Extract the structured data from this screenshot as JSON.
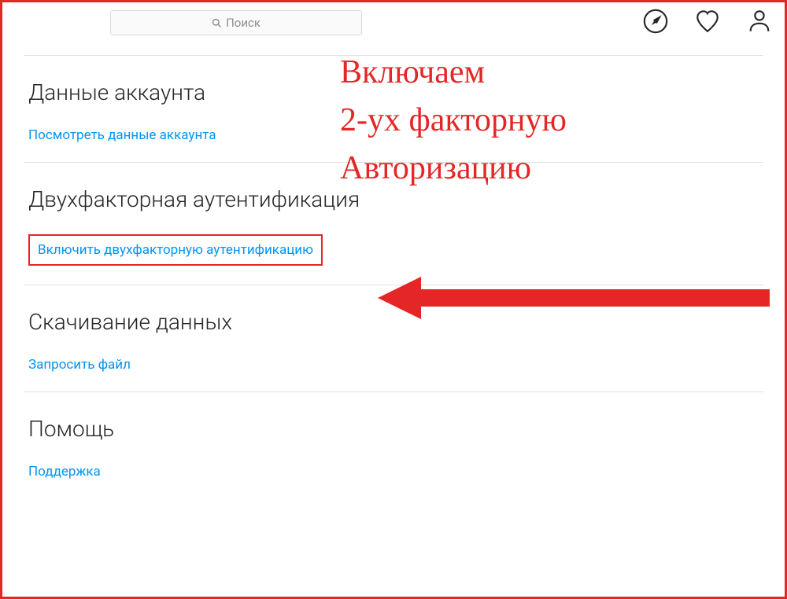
{
  "search": {
    "placeholder": "Поиск"
  },
  "sections": {
    "account": {
      "title": "Данные аккаунта",
      "link": "Посмотреть данные аккаунта"
    },
    "twofactor": {
      "title": "Двухфакторная аутентификация",
      "link": "Включить двухфакторную аутентификацию"
    },
    "download": {
      "title": "Скачивание данных",
      "link": "Запросить файл"
    },
    "help": {
      "title": "Помощь",
      "link": "Поддержка"
    }
  },
  "annotation": {
    "line1": "Включаем",
    "line2": "2-ух факторную",
    "line3": "Авторизацию"
  }
}
